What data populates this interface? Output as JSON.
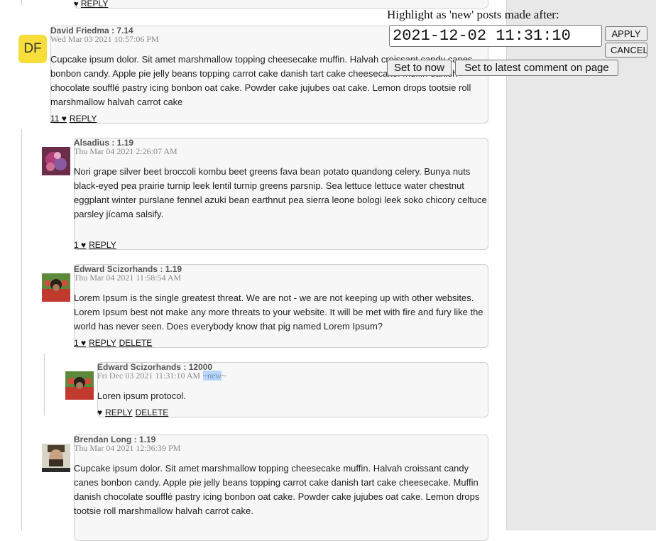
{
  "highlight": {
    "label": "Highlight as 'new' posts made after:",
    "value": "2021-12-02 11:31:10",
    "apply": "APPLY",
    "cancel": "CANCEL",
    "set_now": "Set to now",
    "set_latest": "Set to latest comment on page"
  },
  "top_actions": {
    "heart": "♥",
    "reply": "REPLY"
  },
  "comments": [
    {
      "author": "David Friedma : 7.14",
      "date": "Wed Mar 03 2021 10:57:06 PM",
      "initials": "DF",
      "body": "Cupcake ipsum dolor. Sit amet marshmallow topping cheesecake muffin. Halvah croissant candy canes bonbon candy. Apple pie jelly beans topping carrot cake danish tart cake cheesecake. Muffin danish chocolate soufflé pastry icing bonbon oat cake. Powder cake jujubes oat cake. Lemon drops tootsie roll marshmallow halvah carrot cake",
      "likes": "11 ♥",
      "reply": "REPLY"
    },
    {
      "author": "Alsadius : 1.19",
      "date": "Thu Mar 04 2021 2:26:07 AM",
      "body": "Nori grape silver beet broccoli kombu beet greens fava bean potato quandong celery. Bunya nuts black-eyed pea prairie turnip leek lentil turnip greens parsnip. Sea lettuce lettuce water chestnut eggplant winter purslane fennel azuki bean earthnut pea sierra leone bologi leek soko chicory celtuce parsley jícama salsify.",
      "likes": "1 ♥",
      "reply": "REPLY"
    },
    {
      "author": "Edward Scizorhands : 1.19",
      "date": "Thu Mar 04 2021 11:58:54 AM",
      "body": "Lorem Ipsum is the single greatest threat. We are not - we are not keeping up with other websites. Lorem Ipsum best not make any more threats to your website. It will be met with fire and fury like the world has never seen. Does everybody know that pig named Lorem Ipsum?",
      "likes": "1 ♥",
      "reply": "REPLY",
      "delete": "DELETE"
    },
    {
      "author": "Edward Scizorhands : 12000",
      "date": "Fri Dec 03 2021 11:31:10 AM",
      "new_prefix": "~",
      "new_word": "new",
      "new_suffix": "~",
      "body": "Loren ipsum protocol.",
      "likes": "♥",
      "reply": "REPLY",
      "delete": "DELETE"
    },
    {
      "author": "Brendan Long : 1.19",
      "date": "Thu Mar 04 2021 12:36:39 PM",
      "body": "Cupcake ipsum dolor. Sit amet marshmallow topping cheesecake muffin. Halvah croissant candy canes bonbon candy. Apple pie jelly beans topping carrot cake danish tart cake cheesecake. Muffin danish chocolate soufflé pastry icing bonbon oat cake. Powder cake jujubes oat cake. Lemon drops tootsie roll marshmallow halvah carrot cake."
    }
  ]
}
